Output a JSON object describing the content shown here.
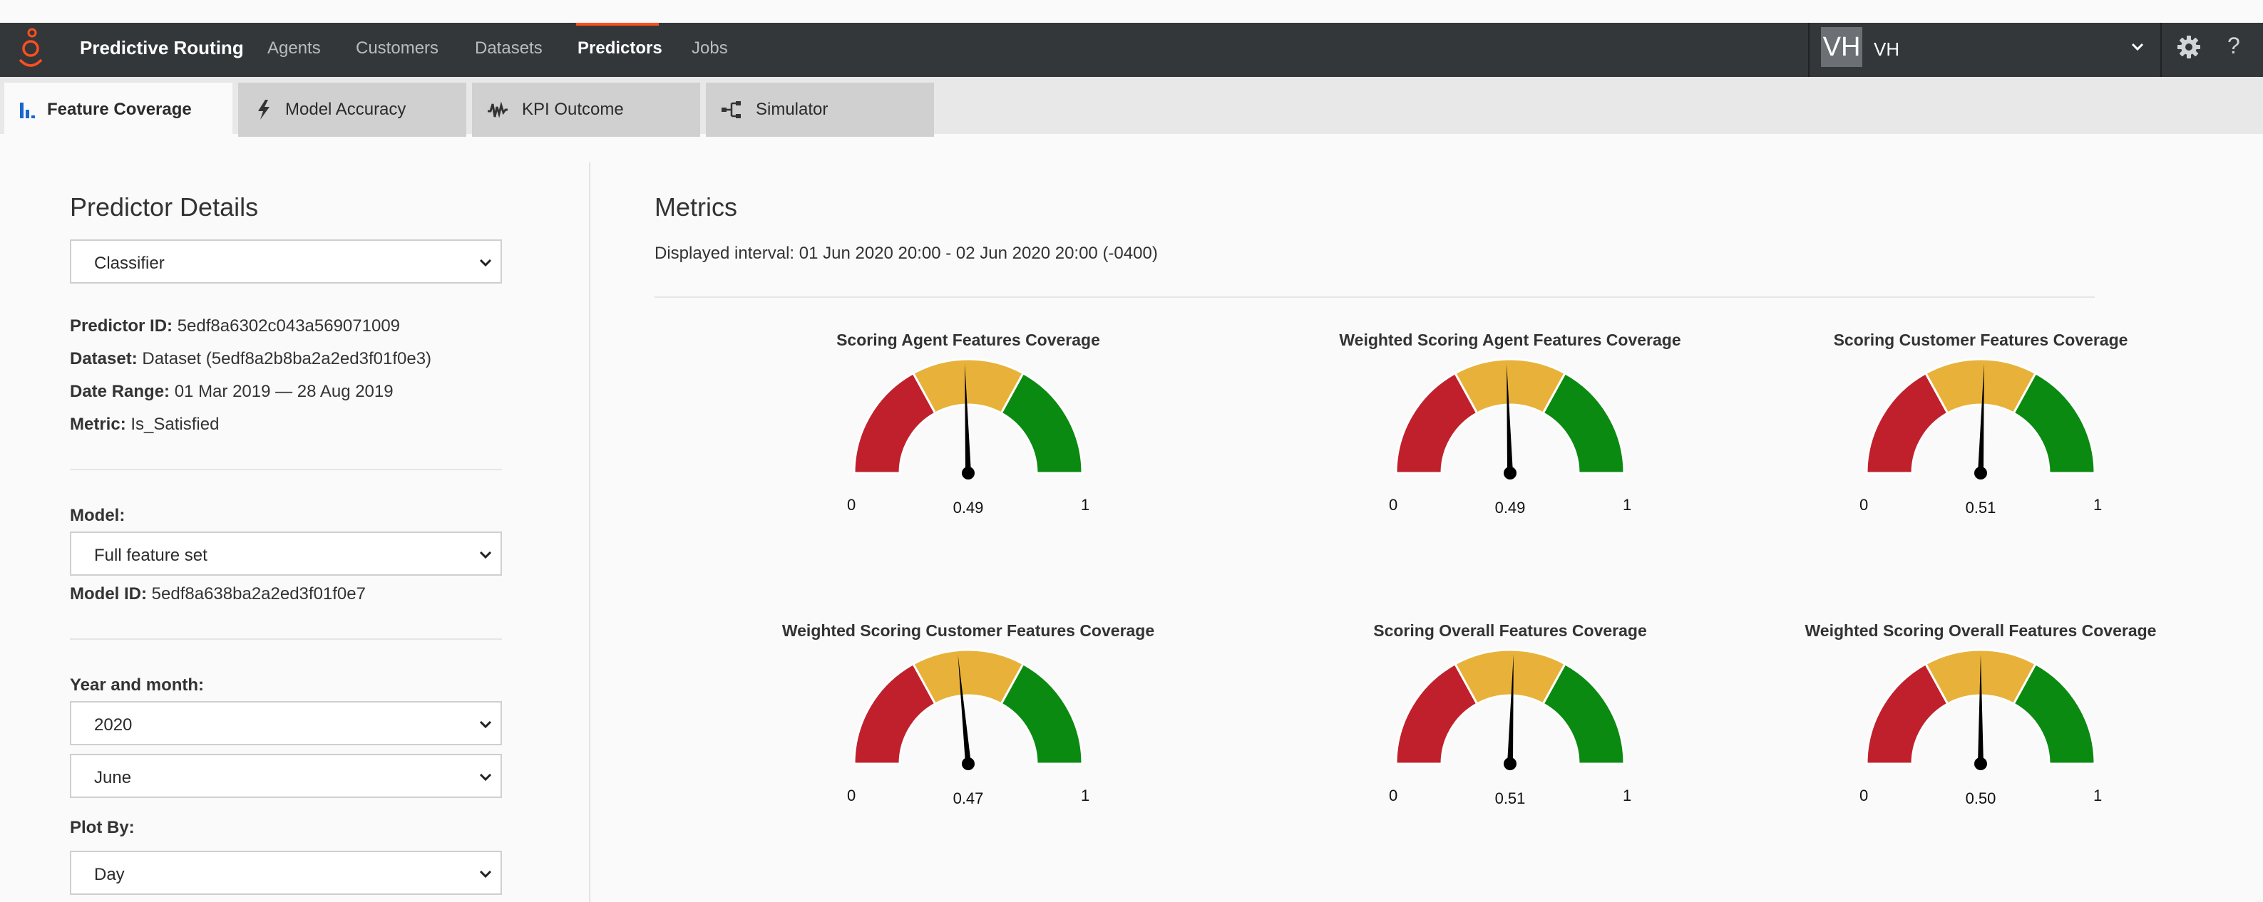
{
  "app": {
    "title": "Predictive Routing",
    "nav": [
      {
        "label": "Agents"
      },
      {
        "label": "Customers"
      },
      {
        "label": "Datasets"
      },
      {
        "label": "Predictors",
        "active": true
      },
      {
        "label": "Jobs"
      }
    ],
    "user": {
      "initials": "VH",
      "name": "VH"
    },
    "help_label": "?"
  },
  "tabs": [
    {
      "label": "Feature Coverage",
      "icon": "bar-chart-icon",
      "active": true
    },
    {
      "label": "Model Accuracy",
      "icon": "lightning-icon"
    },
    {
      "label": "KPI Outcome",
      "icon": "waveform-icon"
    },
    {
      "label": "Simulator",
      "icon": "flow-icon"
    }
  ],
  "predictor": {
    "title": "Predictor Details",
    "type_value": "Classifier",
    "id_label": "Predictor ID:",
    "id_value": "5edf8a6302c043a569071009",
    "dataset_label": "Dataset:",
    "dataset_value": "Dataset (5edf8a2b8ba2a2ed3f01f0e3)",
    "daterange_label": "Date Range:",
    "daterange_value": "01 Mar 2019 — 28 Aug 2019",
    "metric_label": "Metric:",
    "metric_value": "Is_Satisfied",
    "model_label": "Model:",
    "model_value": "Full feature set",
    "model_id_label": "Model ID:",
    "model_id_value": "5edf8a638ba2a2ed3f01f0e7",
    "yearmonth_label": "Year and month:",
    "year_value": "2020",
    "month_value": "June",
    "plotby_label": "Plot By:",
    "plotby_value": "Day"
  },
  "metrics": {
    "title": "Metrics",
    "interval": "Displayed interval: 01 Jun 2020 20:00 - 02 Jun 2020 20:00 (-0400)",
    "colors": {
      "low": "#c0202c",
      "mid": "#e8b23a",
      "high": "#0b8a12",
      "needle": "#000000"
    },
    "gauges": [
      {
        "title": "Scoring Agent Features Coverage",
        "value": 0.49,
        "value_label": "0.49",
        "min_label": "0",
        "max_label": "1"
      },
      {
        "title": "Weighted Scoring Agent Features Coverage",
        "value": 0.49,
        "value_label": "0.49",
        "min_label": "0",
        "max_label": "1"
      },
      {
        "title": "Scoring Customer Features Coverage",
        "value": 0.51,
        "value_label": "0.51",
        "min_label": "0",
        "max_label": "1"
      },
      {
        "title": "Weighted Scoring Customer Features Coverage",
        "value": 0.47,
        "value_label": "0.47",
        "min_label": "0",
        "max_label": "1"
      },
      {
        "title": "Scoring Overall Features Coverage",
        "value": 0.51,
        "value_label": "0.51",
        "min_label": "0",
        "max_label": "1"
      },
      {
        "title": "Weighted Scoring Overall Features Coverage",
        "value": 0.5,
        "value_label": "0.50",
        "min_label": "0",
        "max_label": "1"
      }
    ]
  }
}
